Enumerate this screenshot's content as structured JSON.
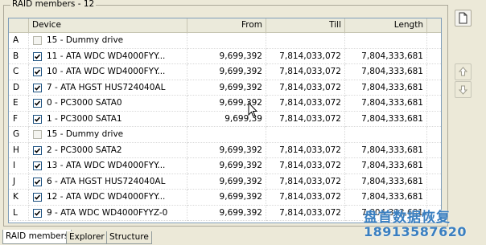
{
  "group_title": "RAID members - 12",
  "columns": {
    "id": "",
    "device": "Device",
    "from": "From",
    "till": "Till",
    "length": "Length"
  },
  "rows": [
    {
      "id": "A",
      "checked": false,
      "enabled": false,
      "device": "15 - Dummy drive",
      "from": "",
      "till": "",
      "length": ""
    },
    {
      "id": "B",
      "checked": true,
      "enabled": true,
      "device": "11 - ATA WDC WD4000FYY...",
      "from": "9,699,392",
      "till": "7,814,033,072",
      "length": "7,804,333,681"
    },
    {
      "id": "C",
      "checked": true,
      "enabled": true,
      "device": "10 - ATA WDC WD4000FYY...",
      "from": "9,699,392",
      "till": "7,814,033,072",
      "length": "7,804,333,681"
    },
    {
      "id": "D",
      "checked": true,
      "enabled": true,
      "device": "7 - ATA HGST HUS724040AL",
      "from": "9,699,392",
      "till": "7,814,033,072",
      "length": "7,804,333,681"
    },
    {
      "id": "E",
      "checked": true,
      "enabled": true,
      "device": "0 - PC3000 SATA0",
      "from": "9,699,392",
      "till": "7,814,033,072",
      "length": "7,804,333,681"
    },
    {
      "id": "F",
      "checked": true,
      "enabled": true,
      "device": "1 - PC3000 SATA1",
      "from": "9,699,39",
      "till": "7,814,033,072",
      "length": "7,804,333,681"
    },
    {
      "id": "G",
      "checked": false,
      "enabled": false,
      "device": "15 - Dummy drive",
      "from": "",
      "till": "",
      "length": ""
    },
    {
      "id": "H",
      "checked": true,
      "enabled": true,
      "device": "2 - PC3000 SATA2",
      "from": "9,699,392",
      "till": "7,814,033,072",
      "length": "7,804,333,681"
    },
    {
      "id": "I",
      "checked": true,
      "enabled": true,
      "device": "13 - ATA WDC WD4000FYY...",
      "from": "9,699,392",
      "till": "7,814,033,072",
      "length": "7,804,333,681"
    },
    {
      "id": "J",
      "checked": true,
      "enabled": true,
      "device": "6 - ATA HGST HUS724040AL",
      "from": "9,699,392",
      "till": "7,814,033,072",
      "length": "7,804,333,681"
    },
    {
      "id": "K",
      "checked": true,
      "enabled": true,
      "device": "12 - ATA WDC WD4000FYY...",
      "from": "9,699,392",
      "till": "7,814,033,072",
      "length": "7,804,333,681"
    },
    {
      "id": "L",
      "checked": true,
      "enabled": true,
      "device": "9 - ATA WDC WD4000FYYZ-0",
      "from": "9,699,392",
      "till": "7,814,033,072",
      "length": "7,804,333,681"
    }
  ],
  "side_buttons": {
    "new": "new-document-icon",
    "up": "arrow-up-icon",
    "down": "arrow-down-icon"
  },
  "tabs": [
    {
      "label": "RAID members",
      "active": true
    },
    {
      "label": "Explorer",
      "active": false
    },
    {
      "label": "Structure",
      "active": false
    }
  ],
  "watermark": {
    "line1": "盘首数据恢复",
    "line2": "18913587620"
  },
  "colors": {
    "accent_check": "#21A121",
    "watermark": "#3A7FC0",
    "window_bg": "#ECE9D8"
  }
}
